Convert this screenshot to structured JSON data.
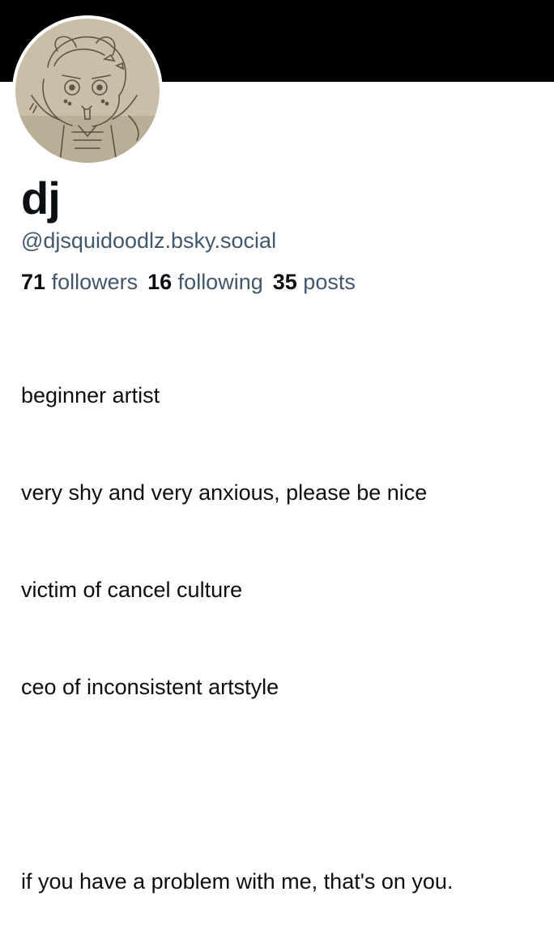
{
  "profile": {
    "display_name": "dj",
    "handle": "@djsquidoodlz.bsky.social",
    "avatar_icon": "sketch-avatar-image",
    "stats": {
      "followers_count": "71",
      "followers_label": "followers",
      "following_count": "16",
      "following_label": "following",
      "posts_count": "35",
      "posts_label": "posts"
    },
    "bio_lines": [
      "beginner artist",
      "very shy and very anxious, please be nice",
      "victim of cancel culture",
      "ceo of inconsistent artstyle",
      "",
      "if you have a problem with me, that's on you."
    ]
  },
  "colors": {
    "banner": "#000000",
    "text_primary": "#0b0f14",
    "text_secondary": "#42576c"
  }
}
